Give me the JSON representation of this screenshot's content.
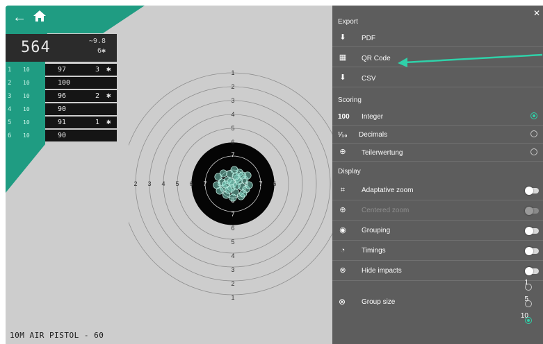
{
  "nav": {
    "back_icon": "back-arrow-icon",
    "home_icon": "home-icon"
  },
  "score": {
    "total": "564",
    "average": "~9.8",
    "inner_tens": "6✱"
  },
  "series": [
    {
      "num": "1",
      "ten": "10",
      "value": "97",
      "inner": "3",
      "star": "✱"
    },
    {
      "num": "2",
      "ten": "10",
      "value": "100",
      "inner": "",
      "star": ""
    },
    {
      "num": "3",
      "ten": "10",
      "value": "96",
      "inner": "2",
      "star": "✱"
    },
    {
      "num": "4",
      "ten": "10",
      "value": "90",
      "inner": "",
      "star": ""
    },
    {
      "num": "5",
      "ten": "10",
      "value": "91",
      "inner": "1",
      "star": "✱"
    },
    {
      "num": "6",
      "ten": "10",
      "value": "90",
      "inner": "",
      "star": ""
    }
  ],
  "discipline": "10M AIR PISTOL - 60",
  "target": {
    "ring_labels_up": [
      "1",
      "2",
      "3",
      "4",
      "5",
      "6",
      "7"
    ],
    "ring_labels_down": [
      "8",
      "7",
      "6",
      "5",
      "4",
      "3",
      "2",
      "1"
    ],
    "ring_labels_left": [
      "1",
      "2",
      "3",
      "4",
      "5",
      "6",
      "7",
      "8"
    ],
    "ring_labels_right": [
      "8",
      "7",
      "6"
    ],
    "center_label": "8",
    "shot_color": "#7fd6c2"
  },
  "panel": {
    "close_icon": "close-icon",
    "export_title": "Export",
    "export_items": [
      {
        "icon": "pdf-icon",
        "label": "PDF"
      },
      {
        "icon": "qr-code-icon",
        "label": "QR Code"
      },
      {
        "icon": "csv-icon",
        "label": "CSV"
      }
    ],
    "scoring_title": "Scoring",
    "scoring_items": [
      {
        "prefix": "100",
        "label": "Integer",
        "selected": true
      },
      {
        "prefix": "¹⁄₁₀",
        "label": "Decimals",
        "selected": false
      },
      {
        "prefix": "",
        "label": "Teilerwertung",
        "selected": false
      }
    ],
    "display_title": "Display",
    "display_items": [
      {
        "icon": "crop-icon",
        "label": "Adaptative zoom",
        "enabled": true
      },
      {
        "icon": "crosshair-icon",
        "label": "Centered zoom",
        "enabled": false
      },
      {
        "icon": "eye-icon",
        "label": "Grouping",
        "enabled": true
      },
      {
        "icon": "clock-icon",
        "label": "Timings",
        "enabled": true
      },
      {
        "icon": "hide-icon",
        "label": "Hide impacts",
        "enabled": true
      }
    ],
    "group_size": {
      "label": "Group size",
      "options": [
        "1",
        "5",
        "10"
      ],
      "selected": "10"
    }
  },
  "colors": {
    "accent": "#2fd1a9",
    "panel": "#5d5d5d",
    "teal": "#1f9c82"
  }
}
